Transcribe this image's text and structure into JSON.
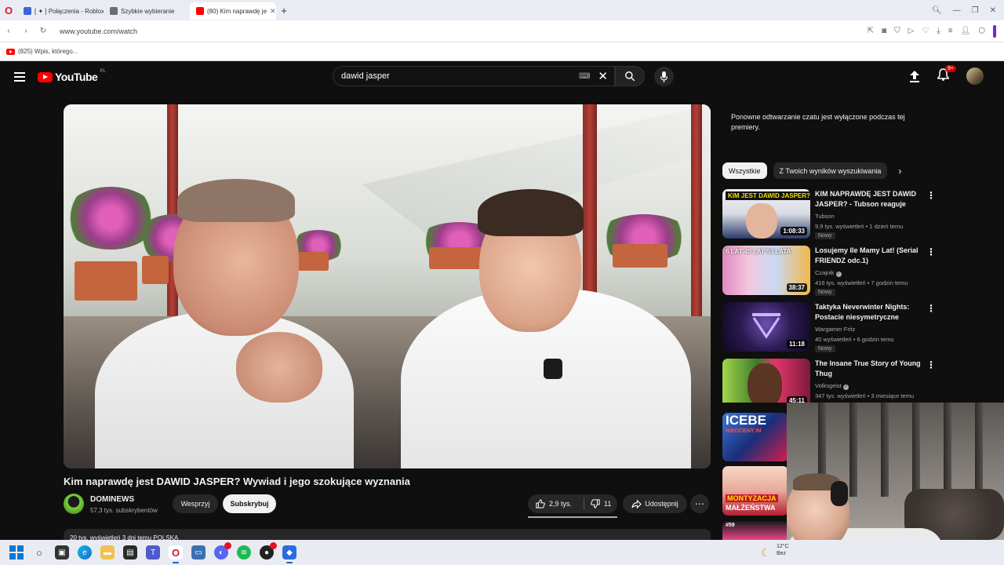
{
  "browser": {
    "tabs": [
      {
        "label": "[ ✦ ] Połączenia - Roblox",
        "color": "#3a66d8"
      },
      {
        "label": "Szybkie wybieranie",
        "color": "#6d6d6d"
      },
      {
        "label": "(80) Kim naprawdę je",
        "color": "#ff0000"
      }
    ],
    "url": "www.youtube.com/watch",
    "bookmark": "(825) Wpis, którego..."
  },
  "yt": {
    "logo": "YouTube",
    "region": "PL",
    "search": "dawid jasper",
    "notifications": "9+"
  },
  "video": {
    "title": "Kim naprawdę jest DAWID JASPER? Wywiad i jego szokujące wyznania",
    "channel": "DOMINEWS",
    "subscribers": "57,3 tys. subskrybentów",
    "support_label": "Wesprzyj",
    "subscribe_label": "Subskrybuj",
    "likes": "2,9 tys.",
    "dislikes": "11",
    "share_label": "Udostępnij",
    "description_preview": "20 tys. wyświetleń  3 dni temu  POLSKA"
  },
  "chat": {
    "message": "Ponowne odtwarzanie czatu jest wyłączone podczas tej premiery."
  },
  "chips": [
    "Wszystkie",
    "Z Twoich wyników wyszukiwania"
  ],
  "recommendations": [
    {
      "title": "KIM NAPRAWDĘ JEST DAWID JASPER? - Tubson reaguje",
      "channel": "Tubson",
      "meta": "9,9 tys. wyświetleń • 1 dzień temu",
      "badge": "Nowy",
      "duration": "1:08:33",
      "thumb_text": "KIM JEST DAWID JASPER?",
      "verified": false
    },
    {
      "title": "Losujemy Ile Mamy Lat! (Serial FRIENDZ odc.1)",
      "channel": "Czajnik",
      "meta": "416 tys. wyświetleń • 7 godzin temu",
      "badge": "Nowy",
      "duration": "38:37",
      "thumb_text": "6 LAT   45 LAT   93 LATA",
      "verified": true
    },
    {
      "title": "Taktyka Neverwinter Nights: Postacie niesymetryczne",
      "channel": "Wargamer Fritz",
      "meta": "40 wyświetleń • 6 godzin temu",
      "badge": "Nowy",
      "duration": "11:18",
      "thumb_text": "",
      "verified": false
    },
    {
      "title": "The Insane True Story of Young Thug",
      "channel": "Volksgeist",
      "meta": "347 tys. wyświetleń • 3 miesiące temu",
      "badge": "",
      "duration": "45:11",
      "thumb_text": "",
      "verified": true
    }
  ],
  "small_thumbs": [
    {
      "caption": "ICEBE",
      "sub": "NIEOCENY IN"
    },
    {
      "caption": "MONTYZACJA",
      "sub": "MAŁŻEŃSTWA"
    },
    {
      "caption": "#59",
      "sub": ""
    }
  ],
  "taskbar": {
    "temp": "12°C",
    "weather_word": "Bez"
  }
}
